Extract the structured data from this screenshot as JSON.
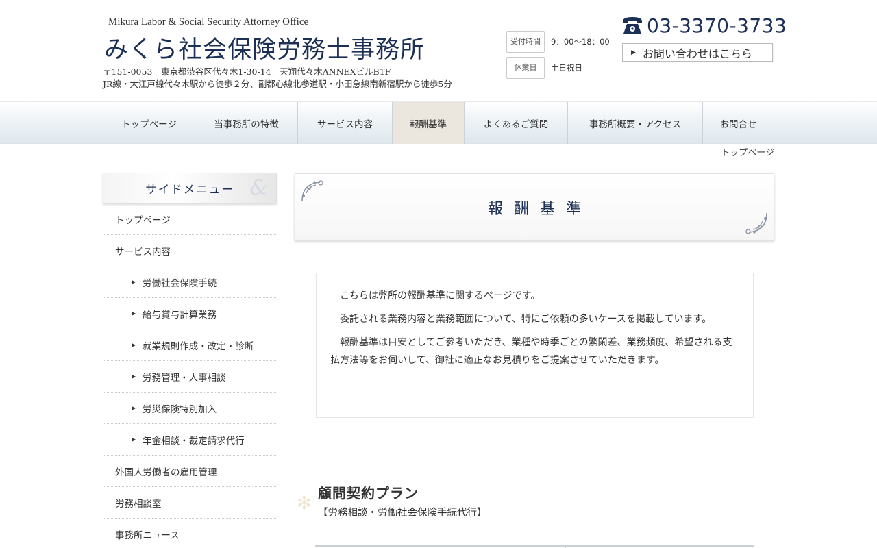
{
  "header": {
    "en_name": "Mikura Labor & Social Security Attorney Office",
    "jp_name": "みくら社会保険労務士事務所",
    "address_line1": "〒151-0053　東京都渋谷区代々木1-30-14　天翔代々木ANNEXビルB1F",
    "address_line2": "JR線・大江戸線代々木駅から徒歩２分、副都心線北参道駅・小田急線南新宿駅から徒歩5分",
    "hours_label": "受付時間",
    "hours_value": "9：00〜18：00",
    "holiday_label": "休業日",
    "holiday_value": "土日祝日",
    "phone": "03-3370-3733",
    "contact_label": "お問い合わせはこちら"
  },
  "nav": {
    "items": [
      {
        "label": "トップページ"
      },
      {
        "label": "当事務所の特徴"
      },
      {
        "label": "サービス内容"
      },
      {
        "label": "報酬基準",
        "active": true
      },
      {
        "label": "よくあるご質問"
      },
      {
        "label": "事務所概要・アクセス"
      },
      {
        "label": "お問合せ"
      }
    ]
  },
  "breadcrumb": "トップページ",
  "sidebar": {
    "heading": "サイドメニュー",
    "items": [
      {
        "label": "トップページ"
      },
      {
        "label": "サービス内容"
      },
      {
        "label": "労働社会保険手続"
      },
      {
        "label": "給与賞与計算業務"
      },
      {
        "label": "就業規則作成・改定・診断"
      },
      {
        "label": "労務管理・人事相談"
      },
      {
        "label": "労災保険特別加入"
      },
      {
        "label": "年金相談・裁定請求代行"
      },
      {
        "label": "外国人労働者の雇用管理"
      },
      {
        "label": "労務相談室"
      },
      {
        "label": "事務所ニュース"
      }
    ]
  },
  "main": {
    "title": "報酬基準",
    "intro": [
      "こちらは弊所の報酬基準に関するページです。",
      "委託される業務内容と業務範囲について、特にご依頼の多いケースを掲載しています。",
      "報酬基準は目安としてご参考いただき、業種や時季ごとの繁閑差、業務頻度、希望される支払方法等をお伺いして、御社に適正なお見積りをご提案させていただきます。"
    ],
    "plan_title": "顧問契約プラン",
    "plan_subtitle": "【労務相談・労働社会保険手続代行】"
  },
  "colors": {
    "brand_navy": "#1c2f55",
    "nav_active_bg": "#ebe7df"
  },
  "icons": {
    "phone": "phone-icon",
    "contact_arrow": "triangle-right-icon",
    "sidebar_arrow": "triangle-right-icon",
    "ornament": "flourish-ornament-icon"
  }
}
